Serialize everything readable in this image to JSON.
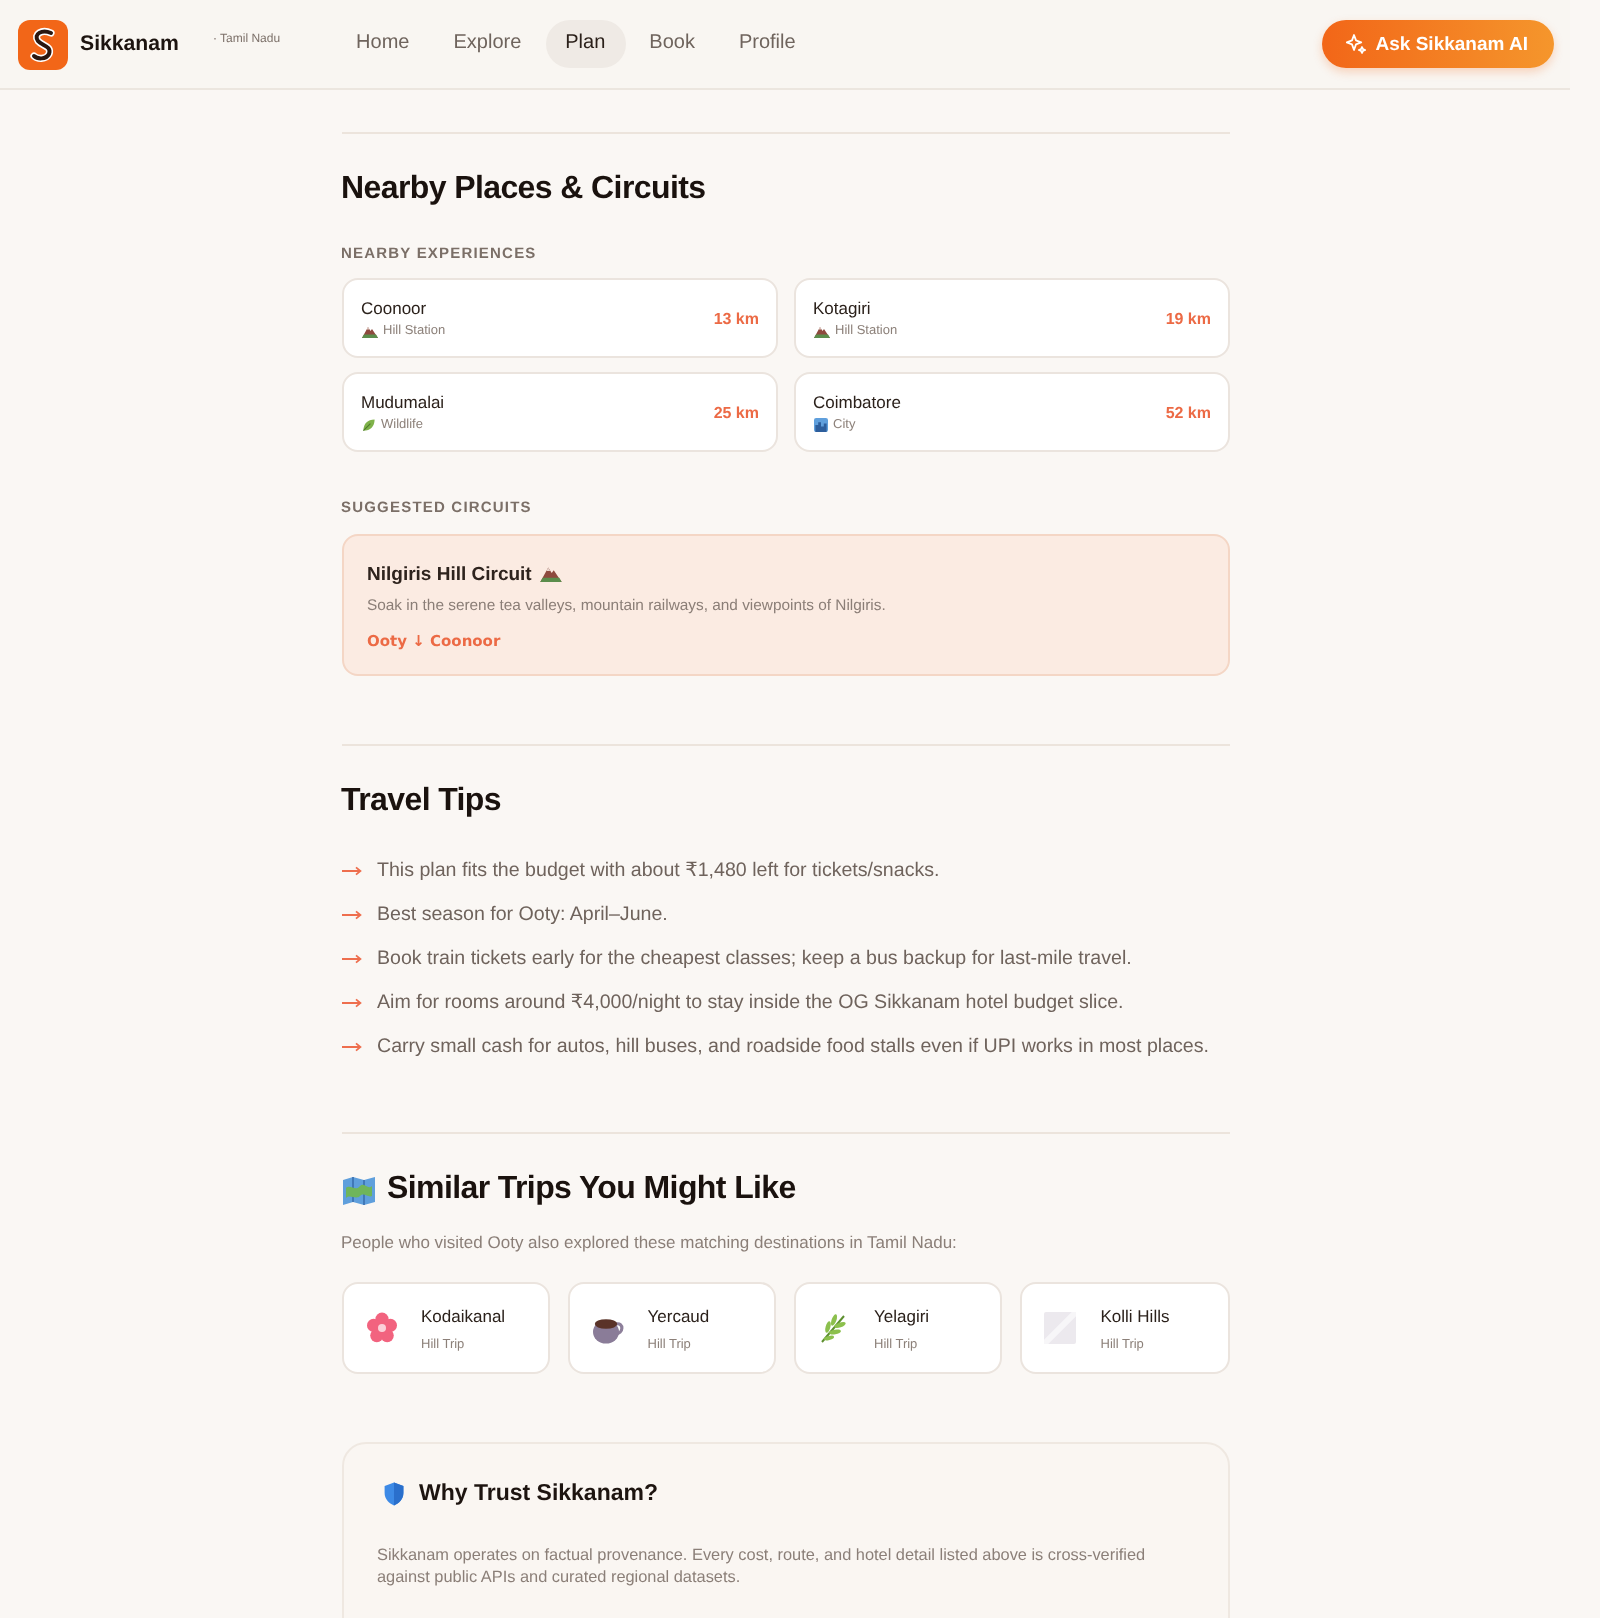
{
  "header": {
    "brand": "Sikkanam",
    "region": "· Tamil Nadu",
    "nav": [
      {
        "label": "Home",
        "selected": false
      },
      {
        "label": "Explore",
        "selected": false
      },
      {
        "label": "Plan",
        "selected": true
      },
      {
        "label": "Book",
        "selected": false
      },
      {
        "label": "Profile",
        "selected": false
      }
    ],
    "cta": "Ask Sikkanam AI"
  },
  "nearby": {
    "title": "Nearby Places & Circuits",
    "experiences_label": "NEARBY EXPERIENCES",
    "places": [
      {
        "name": "Coonoor",
        "kind": "hills",
        "category": "Hill Station",
        "distance": "13 km"
      },
      {
        "name": "Kotagiri",
        "kind": "hills",
        "category": "Hill Station",
        "distance": "19 km"
      },
      {
        "name": "Mudumalai",
        "kind": "wildlife",
        "category": "Wildlife",
        "distance": "25 km"
      },
      {
        "name": "Coimbatore",
        "kind": "city",
        "category": "City",
        "distance": "52 km"
      }
    ],
    "circuits_label": "SUGGESTED CIRCUITS",
    "circuits": [
      {
        "name": "Nilgiris Hill Circuit",
        "description": "Soak in the serene tea valleys, mountain railways, and viewpoints of Nilgiris.",
        "route": "Ooty ↓ Coonoor"
      }
    ]
  },
  "tips": {
    "title": "Travel Tips",
    "items": [
      "This plan fits the budget with about ₹1,480 left for tickets/snacks.",
      "Best season for Ooty: April–June.",
      "Book train tickets early for the cheapest classes; keep a bus backup for last-mile travel.",
      "Aim for rooms around ₹4,000/night to stay inside the OG Sikkanam hotel budget slice.",
      "Carry small cash for autos, hill buses, and roadside food stalls even if UPI works in most places."
    ]
  },
  "similar": {
    "title": "Similar Trips You Might Like",
    "description": "People who visited Ooty also explored these matching destinations in Tamil Nadu:",
    "trips": [
      {
        "name": "Kodaikanal",
        "category": "Hill Trip"
      },
      {
        "name": "Yercaud",
        "category": "Hill Trip"
      },
      {
        "name": "Yelagiri",
        "category": "Hill Trip"
      },
      {
        "name": "Kolli Hills",
        "category": "Hill Trip"
      }
    ]
  },
  "trust": {
    "title": "Why Trust Sikkanam?",
    "text": "Sikkanam operates on factual provenance. Every cost, route, and hotel detail listed above is cross-verified against public APIs and curated regional datasets."
  }
}
